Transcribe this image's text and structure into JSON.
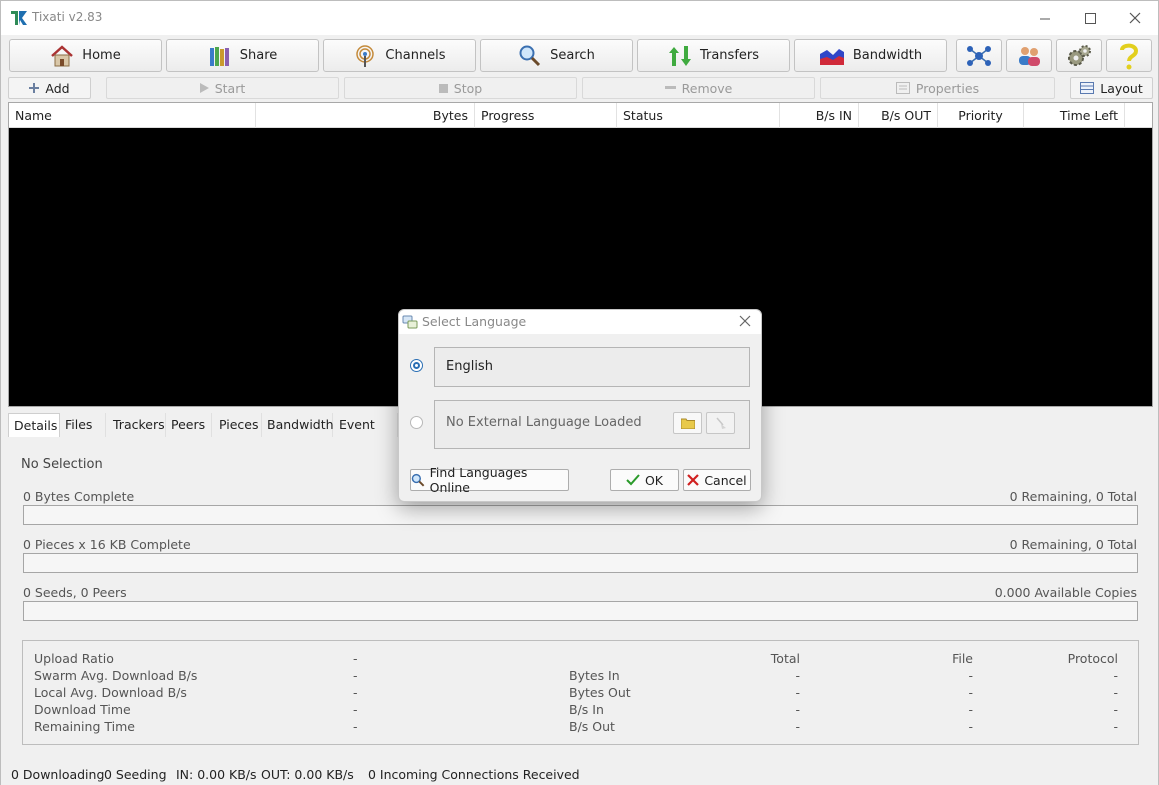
{
  "window": {
    "title": "Tixati v2.83"
  },
  "toolbar": {
    "home": "Home",
    "share": "Share",
    "channels": "Channels",
    "search": "Search",
    "transfers": "Transfers",
    "bandwidth": "Bandwidth"
  },
  "actions": {
    "add": "Add",
    "start": "Start",
    "stop": "Stop",
    "remove": "Remove",
    "properties": "Properties",
    "layout": "Layout"
  },
  "columns": [
    "Name",
    "Bytes",
    "Progress",
    "Status",
    "B/s IN",
    "B/s OUT",
    "Priority",
    "Time Left"
  ],
  "tabs": [
    "Details",
    "Files",
    "Trackers",
    "Peers",
    "Pieces",
    "Bandwidth",
    "Event Log"
  ],
  "details": {
    "selection": "No Selection",
    "bytes_complete": "0 Bytes Complete",
    "bytes_remaining": "0 Remaining,  0 Total",
    "pieces_complete": "0 Pieces  x  16 KB Complete",
    "pieces_remaining": "0 Remaining,  0 Total",
    "seeds_peers": "0 Seeds, 0 Peers",
    "available_copies": "0.000 Available Copies"
  },
  "stats": {
    "left_labels": [
      "Upload Ratio",
      "Swarm Avg. Download B/s",
      "Local Avg. Download B/s",
      "Download Time",
      "Remaining Time"
    ],
    "left_values": [
      "-",
      "-",
      "-",
      "-",
      "-"
    ],
    "headers": {
      "total": "Total",
      "file": "File",
      "protocol": "Protocol"
    },
    "right_labels": [
      "Bytes In",
      "Bytes Out",
      "B/s In",
      "B/s Out"
    ],
    "total_values": [
      "-",
      "-",
      "-",
      "-"
    ],
    "file_values": [
      "-",
      "-",
      "-",
      "-"
    ],
    "protocol_values": [
      "-",
      "-",
      "-",
      "-"
    ]
  },
  "statusbar": {
    "downloading": "0 Downloading",
    "seeding": "0 Seeding",
    "in": "IN: 0.00 KB/s",
    "out": "OUT: 0.00 KB/s",
    "connections": "0 Incoming Connections Received"
  },
  "dialog": {
    "title": "Select Language",
    "option_english": "English",
    "option_external": "No External Language Loaded",
    "find_online": "Find Languages Online",
    "ok": "OK",
    "cancel": "Cancel"
  }
}
